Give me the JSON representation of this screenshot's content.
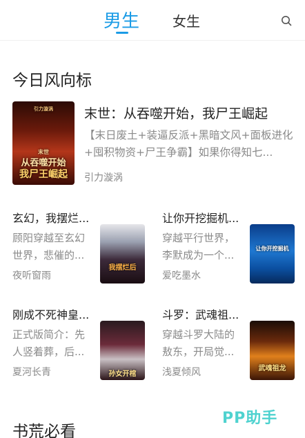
{
  "tabs": {
    "male": "男生",
    "female": "女生"
  },
  "sections": {
    "today": "今日风向标",
    "must_read": "书荒必看"
  },
  "featured": {
    "title": "末世：从吞噬开始，我尸王崛起",
    "description": "【末日废土+装逼反派+黑暗文风+面板进化+囤积物资+尸王争霸】如果你得知七...",
    "author": "引力漩涡",
    "cover_text_1": "从吞噬开始",
    "cover_text_2": "我尸王崛起",
    "cover_top": "末世",
    "cover_publisher": "引力漩涡"
  },
  "books": [
    {
      "title": "玄幻，我摆烂...",
      "description": "顾阳穿越至玄幻世界，悲催的...",
      "author": "夜听窗雨",
      "cover_text": "我摆烂后"
    },
    {
      "title": "让你开挖掘机...",
      "description": "穿越平行世界，李默成为一个...",
      "author": "爱吃墨水",
      "cover_text": "让你开挖掘机"
    },
    {
      "title": "刚成不死神皇...",
      "description": "正式版简介：先人竖着葬，后...",
      "author": "夏河长青",
      "cover_text": "孙女开棺"
    },
    {
      "title": "斗罗：武魂祖...",
      "description": "穿越斗罗大陆的敖东，开局觉...",
      "author": "浅夏倾风",
      "cover_text": "武魂祖龙"
    }
  ],
  "watermark": "PP助手",
  "colors": {
    "accent": "#1a9be6",
    "watermark": "#4fd2cf",
    "muted": "#8a8a8a"
  }
}
